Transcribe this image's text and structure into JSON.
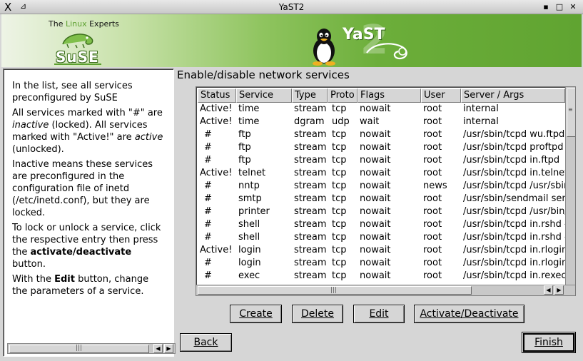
{
  "window": {
    "title": "YaST2",
    "close_glyph": "X",
    "pin_glyph": "⊿",
    "minimize_glyph": "▪",
    "maximize_glyph": "□",
    "close_btn_glyph": "✕"
  },
  "banner": {
    "brand_prefix": "The ",
    "brand_accent": "Linux",
    "brand_suffix": " Experts",
    "suse_logo": "SuSE",
    "yast_logo": "YaST",
    "yast_2": "2"
  },
  "help": {
    "p1": "In the list, see all services preconfigured by SuSE",
    "p2a": "All services marked with \"#\" are ",
    "p2b": "inactive",
    "p2c": " (locked). All services marked with \"Active!\" are ",
    "p2d": "active",
    "p2e": " (unlocked).",
    "p3": "Inactive means these services are preconfigured in the configuration file of inetd (/etc/inetd.conf), but they are locked.",
    "p4a": "To lock or unlock a service, click the respective entry then press the ",
    "p4b": "activate/deactivate",
    "p4c": " button.",
    "p5a": "With the ",
    "p5b": "Edit",
    "p5c": " button, change the parameters of a service."
  },
  "main": {
    "title": "Enable/disable network services"
  },
  "table": {
    "columns": [
      "Status",
      "Service",
      "Type",
      "Proto",
      "Flags",
      "User",
      "Server / Args"
    ],
    "rows": [
      [
        "Active!",
        "time",
        "stream",
        "tcp",
        "nowait",
        "root",
        "internal"
      ],
      [
        "Active!",
        "time",
        "dgram",
        "udp",
        "wait",
        "root",
        "internal"
      ],
      [
        "#",
        "ftp",
        "stream",
        "tcp",
        "nowait",
        "root",
        "/usr/sbin/tcpd wu.ftpd -"
      ],
      [
        "#",
        "ftp",
        "stream",
        "tcp",
        "nowait",
        "root",
        "/usr/sbin/tcpd proftpd"
      ],
      [
        "#",
        "ftp",
        "stream",
        "tcp",
        "nowait",
        "root",
        "/usr/sbin/tcpd in.ftpd"
      ],
      [
        "Active!",
        "telnet",
        "stream",
        "tcp",
        "nowait",
        "root",
        "/usr/sbin/tcpd in.telnetd"
      ],
      [
        "#",
        "nntp",
        "stream",
        "tcp",
        "nowait",
        "news",
        "/usr/sbin/tcpd /usr/sbin"
      ],
      [
        "#",
        "smtp",
        "stream",
        "tcp",
        "nowait",
        "root",
        "/usr/sbin/sendmail sen"
      ],
      [
        "#",
        "printer",
        "stream",
        "tcp",
        "nowait",
        "root",
        "/usr/sbin/tcpd /usr/bin/l"
      ],
      [
        "#",
        "shell",
        "stream",
        "tcp",
        "nowait",
        "root",
        "/usr/sbin/tcpd in.rshd -"
      ],
      [
        "#",
        "shell",
        "stream",
        "tcp",
        "nowait",
        "root",
        "/usr/sbin/tcpd in.rshd -"
      ],
      [
        "Active!",
        "login",
        "stream",
        "tcp",
        "nowait",
        "root",
        "/usr/sbin/tcpd in.rlogind"
      ],
      [
        "#",
        "login",
        "stream",
        "tcp",
        "nowait",
        "root",
        "/usr/sbin/tcpd in.rlogind"
      ],
      [
        "#",
        "exec",
        "stream",
        "tcp",
        "nowait",
        "root",
        "/usr/sbin/tcpd in.rexecd"
      ]
    ]
  },
  "scroll": {
    "grip": "|||",
    "left_arrow": "◀",
    "right_arrow": "▶"
  },
  "buttons": {
    "create": "Create",
    "delete": "Delete",
    "edit": "Edit",
    "activate": "Activate/Deactivate",
    "back": "Back",
    "finish": "Finish"
  },
  "colors": {
    "banner_green": "#6cae3a",
    "accent_green": "#5ca02f",
    "background": "#d6d6d6"
  }
}
